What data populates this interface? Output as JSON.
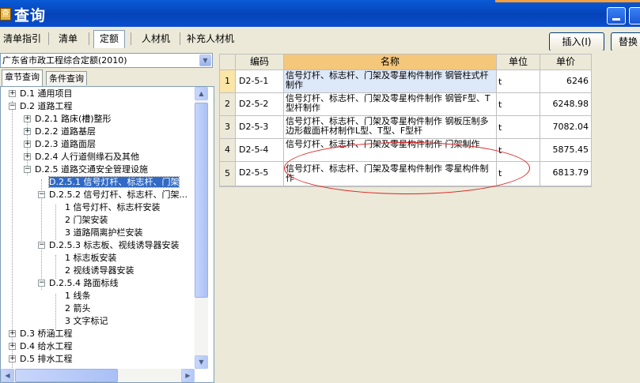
{
  "window": {
    "title": "查询",
    "app_icon": "window-icon"
  },
  "tabs": [
    {
      "label": "清单指引"
    },
    {
      "label": "清单"
    },
    {
      "label": "定额",
      "active": true
    },
    {
      "label": "人材机"
    },
    {
      "label": "补充人材机"
    }
  ],
  "actions": {
    "insert_label": "插入(I)",
    "replace_label": "替换"
  },
  "left": {
    "dropdown_value": "广东省市政工程综合定额(2010)",
    "subtabs": [
      {
        "label": "章节查询",
        "active": true
      },
      {
        "label": "条件查询"
      }
    ],
    "tree": [
      {
        "label": "D.1 通用项目",
        "expander": "+"
      },
      {
        "label": "D.2 道路工程",
        "expander": "−"
      },
      {
        "label": "D.2.1 路床(槽)整形",
        "expander": "+"
      },
      {
        "label": "D.2.2 道路基层",
        "expander": "+"
      },
      {
        "label": "D.2.3 道路面层",
        "expander": "+"
      },
      {
        "label": "D.2.4 人行道侧缘石及其他",
        "expander": "+"
      },
      {
        "label": "D.2.5 道路交通安全管理设施",
        "expander": "−"
      },
      {
        "label": "D.2.5.1 信号灯杆、标志杆、门架",
        "selected": true
      },
      {
        "label": "D.2.5.2 信号灯杆、标志杆、门架...",
        "expander": "−"
      },
      {
        "label": "1 信号灯杆、标志杆安装"
      },
      {
        "label": "2 门架安装"
      },
      {
        "label": "3 道路隔离护栏安装"
      },
      {
        "label": "D.2.5.3 标志板、视线诱导器安装",
        "expander": "−"
      },
      {
        "label": "1 标志板安装"
      },
      {
        "label": "2 视线诱导器安装"
      },
      {
        "label": "D.2.5.4 路面标线",
        "expander": "−"
      },
      {
        "label": "1 线条"
      },
      {
        "label": "2 箭头"
      },
      {
        "label": "3 文字标记"
      },
      {
        "label": "D.3 桥涵工程",
        "expander": "+"
      },
      {
        "label": "D.4 给水工程",
        "expander": "+"
      },
      {
        "label": "D.5 排水工程",
        "expander": "+"
      }
    ]
  },
  "grid": {
    "headers": {
      "code": "编码",
      "name": "名称",
      "unit": "单位",
      "price": "单价"
    },
    "rows": [
      {
        "num": "1",
        "code": "D2-5-1",
        "name": "信号灯杆、标志杆、门架及零星构件制作 钢管柱式杆制作",
        "unit": "t",
        "price": "6246",
        "selected": true
      },
      {
        "num": "2",
        "code": "D2-5-2",
        "name": "信号灯杆、标志杆、门架及零星构件制作 钢管F型、T型杆制作",
        "unit": "t",
        "price": "6248.98"
      },
      {
        "num": "3",
        "code": "D2-5-3",
        "name": "信号灯杆、标志杆、门架及零星构件制作 钢板压制多边形截面杆材制作L型、T型、F型杆",
        "unit": "t",
        "price": "7082.04"
      },
      {
        "num": "4",
        "code": "D2-5-4",
        "name": "信号灯杆、标志杆、门架及零星构件制作 门架制作",
        "unit": "t",
        "price": "5875.45"
      },
      {
        "num": "5",
        "code": "D2-5-5",
        "name": "信号灯杆、标志杆、门架及零星构件制作 零星构件制作",
        "unit": "t",
        "price": "6813.79"
      }
    ]
  },
  "annotation_color": "#dd2222"
}
